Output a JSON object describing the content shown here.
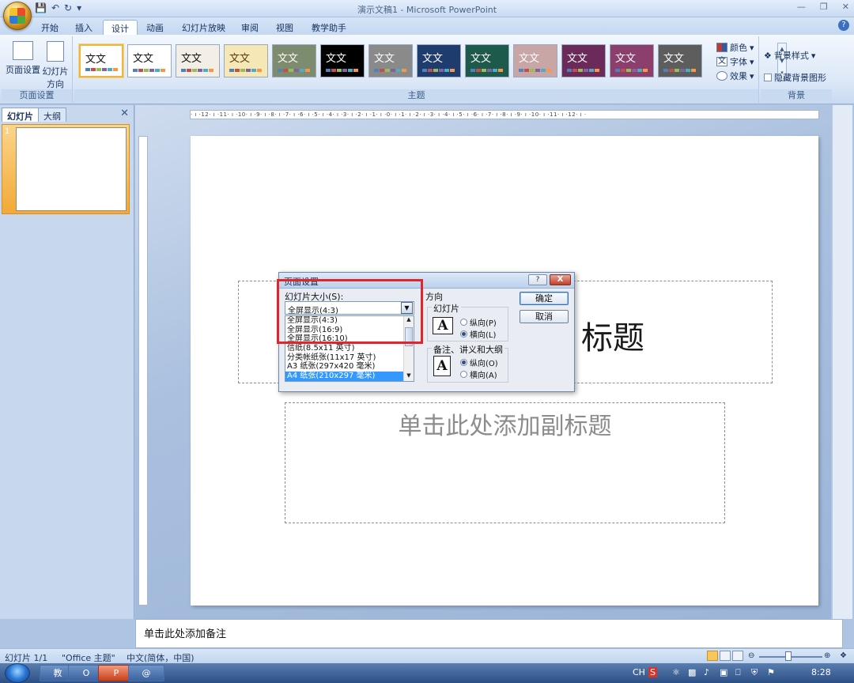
{
  "window": {
    "title": "演示文稿1 - Microsoft PowerPoint",
    "qat_icons": [
      "save-icon",
      "undo-icon",
      "redo-icon",
      "customize-icon"
    ]
  },
  "tabs": [
    {
      "label": "开始"
    },
    {
      "label": "插入"
    },
    {
      "label": "设计",
      "active": true
    },
    {
      "label": "动画"
    },
    {
      "label": "幻灯片放映"
    },
    {
      "label": "审阅"
    },
    {
      "label": "视图"
    },
    {
      "label": "教学助手"
    }
  ],
  "ribbon": {
    "page_setup_group": {
      "label": "页面设置",
      "page_setup_btn": "页面设置",
      "orientation_btn": "幻灯片",
      "orientation_btn_line2": "方向"
    },
    "themes_group": {
      "label": "主题",
      "theme_text": "文文",
      "themes": [
        {
          "bg": "#ffffff",
          "fg": "#111111"
        },
        {
          "bg": "#ffffff",
          "fg": "#111111"
        },
        {
          "bg": "#f3efe6",
          "fg": "#111111"
        },
        {
          "bg": "#f6e7b7",
          "fg": "#5a3a10"
        },
        {
          "bg": "#7d8c6e",
          "fg": "#ffffff"
        },
        {
          "bg": "#000000",
          "fg": "#ffffff"
        },
        {
          "bg": "#8a8a8a",
          "fg": "#ffffff"
        },
        {
          "bg": "#1f3c6e",
          "fg": "#ffffff"
        },
        {
          "bg": "#1e5a4c",
          "fg": "#ffffff"
        },
        {
          "bg": "#c9a6a6",
          "fg": "#ffffff"
        },
        {
          "bg": "#6b2a5a",
          "fg": "#ffffff"
        },
        {
          "bg": "#8c3e6c",
          "fg": "#ffffff"
        },
        {
          "bg": "#5d5d5d",
          "fg": "#ffffff"
        }
      ],
      "colors_btn": "颜色",
      "fonts_btn": "字体",
      "effects_btn": "效果"
    },
    "background_group": {
      "label": "背景",
      "bg_styles_btn": "背景样式",
      "hide_bg_graphics": "隐藏背景图形"
    }
  },
  "leftpane": {
    "tab_slides": "幻灯片",
    "tab_outline": "大纲",
    "slide_number": "1"
  },
  "ruler": {
    "text": "· ı ·12· ı ·11· ı ·10· ı ·9· ı ·8· ı ·7· ı ·6· ı ·5· ı ·4· ı ·3· ı ·2· ı ·1· ı ·0· ı ·1· ı ·2· ı ·3· ı ·4· ı ·5· ı ·6· ı ·7· ı ·8· ı ·9· ı ·10· ı ·11· ı ·12· ı ·"
  },
  "slide": {
    "title_placeholder": "标题",
    "subtitle_placeholder": "单击此处添加副标题"
  },
  "notes": {
    "placeholder": "单击此处添加备注"
  },
  "statusbar": {
    "slide_count": "幻灯片 1/1",
    "theme": "\"Office 主题\"",
    "language": "中文(简体，中国)"
  },
  "dialog": {
    "title": "页面设置",
    "size_label": "幻灯片大小(S):",
    "size_value": "全屏显示(4:3)",
    "size_options": [
      "全屏显示(4:3)",
      "全屏显示(16:9)",
      "全屏显示(16:10)",
      "信纸(8.5x11 英寸)",
      "分类帐纸张(11x17 英寸)",
      "A3 纸张(297x420 毫米)",
      "A4 纸张(210x297 毫米)"
    ],
    "selected_option_index": 6,
    "orientation_label": "方向",
    "slides_label": "幻灯片",
    "portrait": "纵向(P)",
    "landscape": "横向(L)",
    "notes_label": "备注、讲义和大纲",
    "notes_portrait": "纵向(O)",
    "notes_landscape": "横向(A)",
    "ok": "确定",
    "cancel": "取消",
    "help": "?",
    "close": "X",
    "icon_letter": "A"
  },
  "taskbar": {
    "apps": [
      "教",
      "O",
      "P",
      "@"
    ],
    "tray_lang": "CH",
    "time": "8:28"
  }
}
